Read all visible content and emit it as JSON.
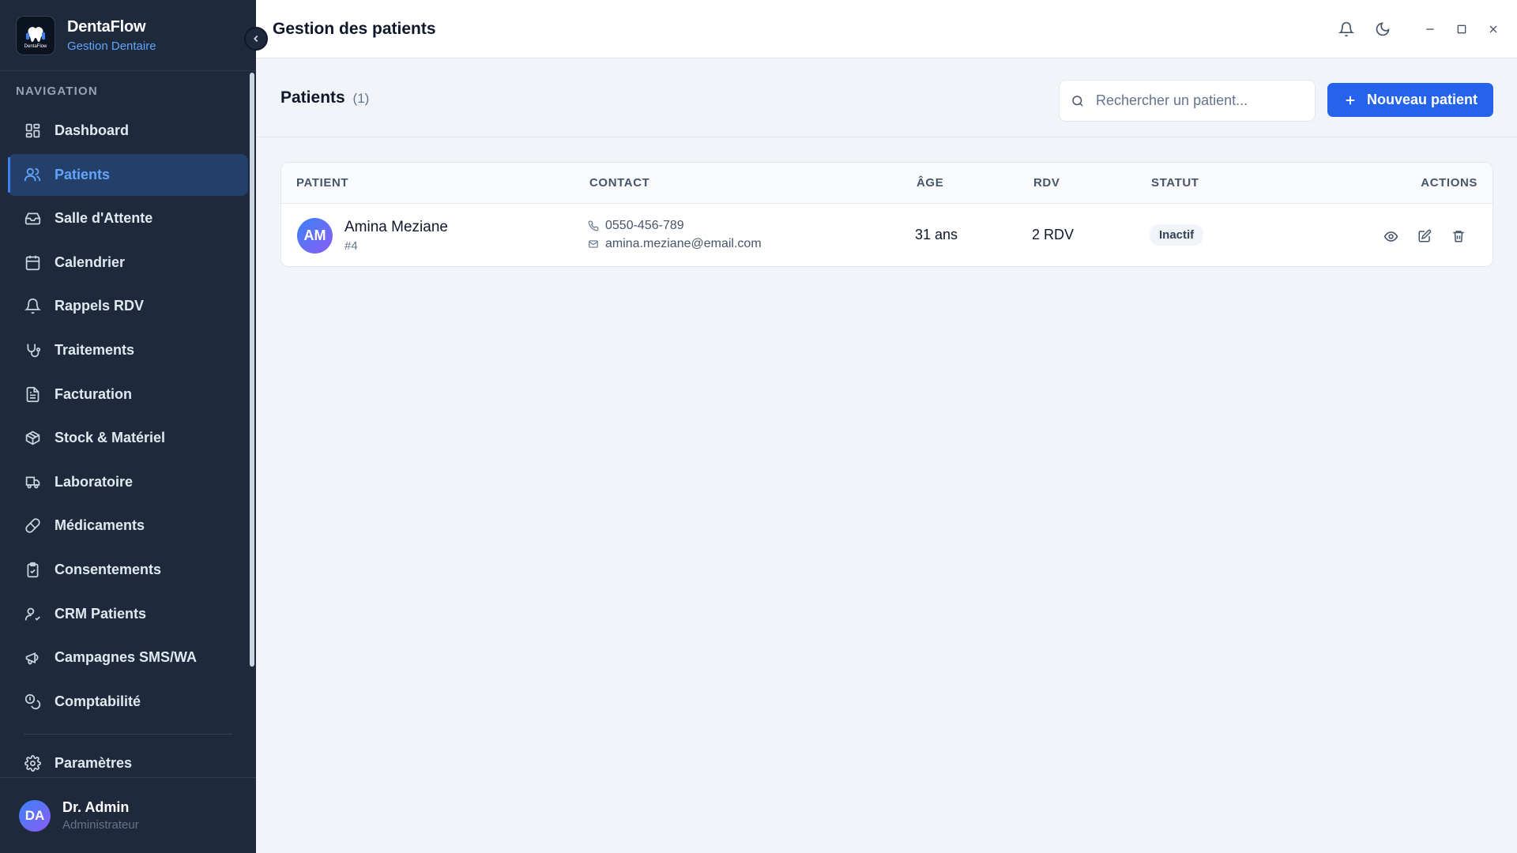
{
  "app": {
    "name": "DentaFlow",
    "subtitle": "Gestion Dentaire",
    "logo_text": "DentaFlow"
  },
  "sidebar": {
    "heading": "NAVIGATION",
    "items": [
      {
        "label": "Dashboard",
        "icon": "dashboard-icon",
        "active": false
      },
      {
        "label": "Patients",
        "icon": "users-icon",
        "active": true
      },
      {
        "label": "Salle d'Attente",
        "icon": "inbox-icon",
        "active": false
      },
      {
        "label": "Calendrier",
        "icon": "calendar-icon",
        "active": false
      },
      {
        "label": "Rappels RDV",
        "icon": "bell-icon",
        "active": false
      },
      {
        "label": "Traitements",
        "icon": "stethoscope-icon",
        "active": false
      },
      {
        "label": "Facturation",
        "icon": "file-text-icon",
        "active": false
      },
      {
        "label": "Stock & Matériel",
        "icon": "package-icon",
        "active": false
      },
      {
        "label": "Laboratoire",
        "icon": "truck-icon",
        "active": false
      },
      {
        "label": "Médicaments",
        "icon": "pill-icon",
        "active": false
      },
      {
        "label": "Consentements",
        "icon": "clipboard-check-icon",
        "active": false
      },
      {
        "label": "CRM Patients",
        "icon": "user-check-icon",
        "active": false
      },
      {
        "label": "Campagnes SMS/WA",
        "icon": "megaphone-icon",
        "active": false
      },
      {
        "label": "Comptabilité",
        "icon": "coins-icon",
        "active": false
      }
    ],
    "settings": {
      "label": "Paramètres",
      "icon": "gear-icon"
    },
    "user": {
      "initials": "DA",
      "name": "Dr. Admin",
      "role": "Administrateur"
    }
  },
  "topbar": {
    "title": "Gestion des patients"
  },
  "main": {
    "title": "Patients",
    "count": "(1)",
    "search_placeholder": "Rechercher un patient...",
    "new_button": "Nouveau patient",
    "columns": [
      "PATIENT",
      "CONTACT",
      "ÂGE",
      "RDV",
      "STATUT",
      "ACTIONS"
    ],
    "rows": [
      {
        "initials": "AM",
        "name": "Amina Meziane",
        "id": "#4",
        "phone": "0550-456-789",
        "email": "amina.meziane@email.com",
        "age": "31 ans",
        "rdv": "2 RDV",
        "status": "Inactif"
      }
    ]
  },
  "colors": {
    "sidebar_bg": "#1e293b",
    "accent": "#2563eb",
    "active_text": "#60a5fa"
  }
}
